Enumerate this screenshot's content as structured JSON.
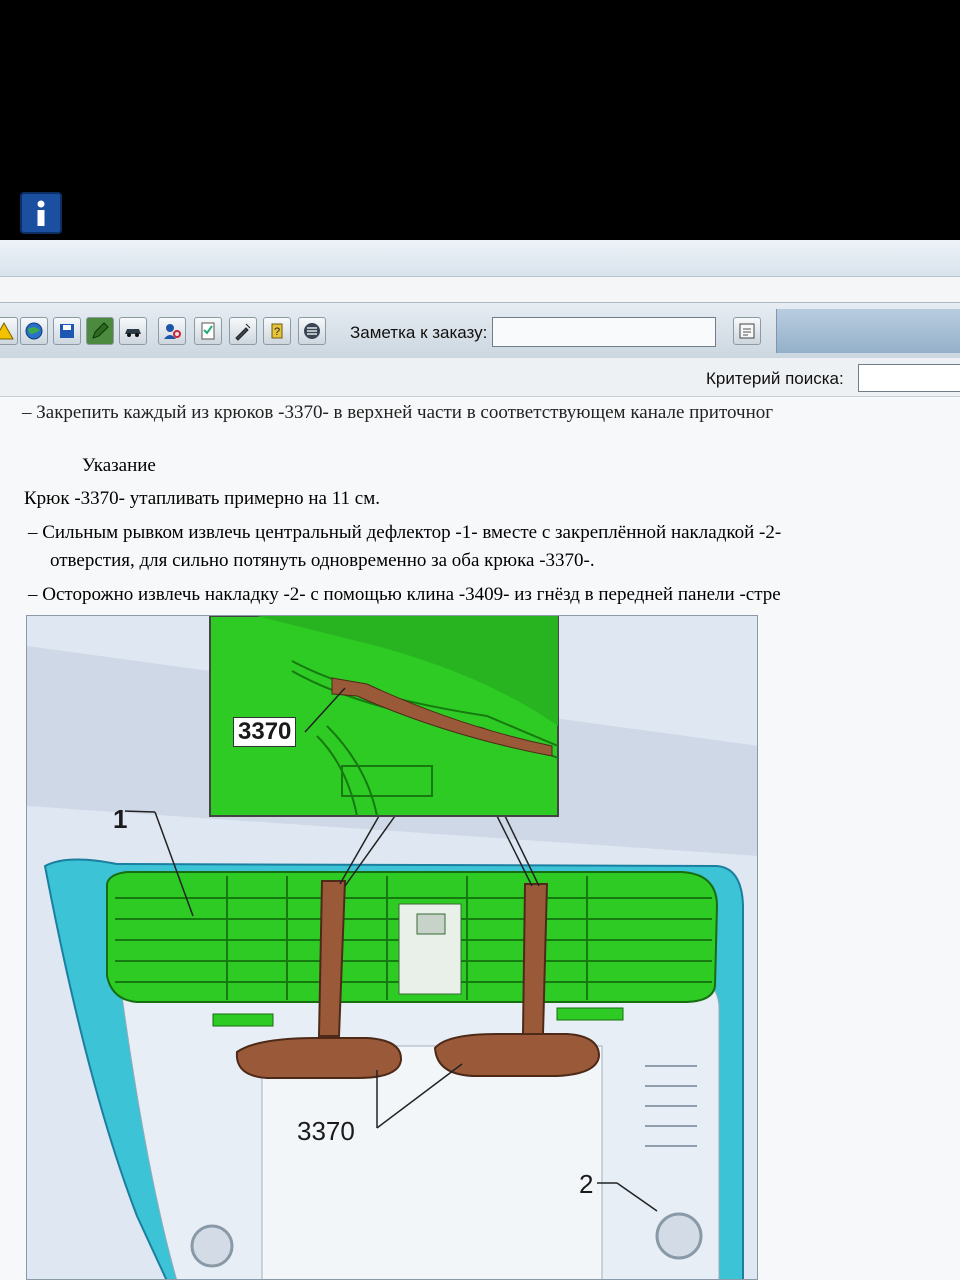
{
  "toolbar": {
    "buttons": [
      "warning-icon",
      "globe-icon",
      "save-icon",
      "pencil-icon",
      "car-icon",
      "person-search-icon",
      "checklist-icon",
      "tools-icon",
      "help-icon",
      "list-icon"
    ],
    "note_label": "Заметка к заказу:",
    "note_value": ""
  },
  "search": {
    "label": "Критерий  поиска:",
    "value": ""
  },
  "doc": {
    "line1": "– Закрепить каждый из крюков -3370- в верхней части в соответствующем канале приточног",
    "note_heading": "Указание",
    "note_text": "Крюк -3370- утапливать примерно на 11 см.",
    "step2_line1": "– Сильным рывком извлечь центральный дефлектор -1- вместе с закреплённой накладкой -2-",
    "step2_line2": "отверстия, для сильно потянуть одновременно за оба крюка -3370-.",
    "step3": "– Осторожно извлечь накладку -2- с помощью клина -3409- из гнёзд в передней панели -стре"
  },
  "figure": {
    "inset_label": "3370",
    "label_1": "1",
    "label_3370": "3370",
    "label_2": "2",
    "colors": {
      "deflector": "#2ecb24",
      "panel_blue": "#3cc3d6",
      "hook": "#9a5a3a",
      "background": "#dfe7f2"
    }
  }
}
